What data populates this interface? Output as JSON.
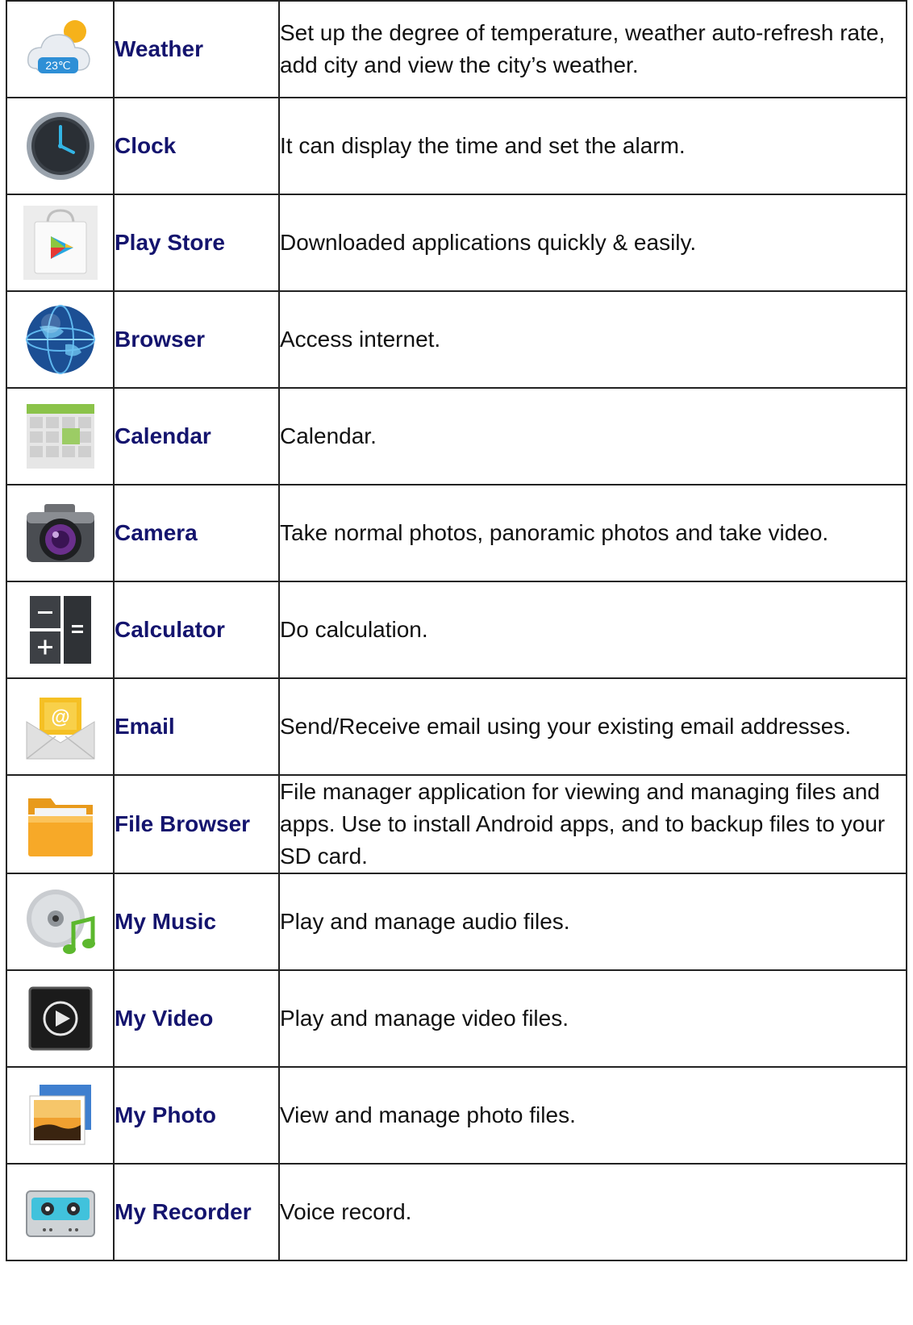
{
  "apps": [
    {
      "icon": "weather-icon",
      "icon_text": "23℃",
      "name": "Weather",
      "description": "Set up the degree of temperature, weather auto-refresh rate, add city and view the city’s weather."
    },
    {
      "icon": "clock-icon",
      "name": "Clock",
      "description": "It can display the time and set the alarm."
    },
    {
      "icon": "play-store-icon",
      "name": "Play Store",
      "description": "Downloaded applications quickly & easily."
    },
    {
      "icon": "browser-globe-icon",
      "name": "Browser",
      "description": "Access internet."
    },
    {
      "icon": "calendar-icon",
      "name": "Calendar",
      "description": "Calendar."
    },
    {
      "icon": "camera-icon",
      "name": "Camera",
      "description": "Take normal photos, panoramic photos and take video."
    },
    {
      "icon": "calculator-icon",
      "name": "Calculator",
      "description": "Do calculation."
    },
    {
      "icon": "email-icon",
      "icon_text": "@",
      "name": "Email",
      "description": "Send/Receive email using your existing email addresses."
    },
    {
      "icon": "folder-icon",
      "name": "File Browser",
      "description": "File manager application for viewing and managing files and apps. Use to install Android apps, and to backup files to your SD card."
    },
    {
      "icon": "music-disc-icon",
      "name": "My Music",
      "description": "Play and manage audio files."
    },
    {
      "icon": "video-play-icon",
      "name": "My Video",
      "description": "Play and manage video files."
    },
    {
      "icon": "photo-icon",
      "name": "My Photo",
      "description": "View and manage photo files."
    },
    {
      "icon": "cassette-recorder-icon",
      "name": "My Recorder",
      "description": "Voice record."
    }
  ]
}
